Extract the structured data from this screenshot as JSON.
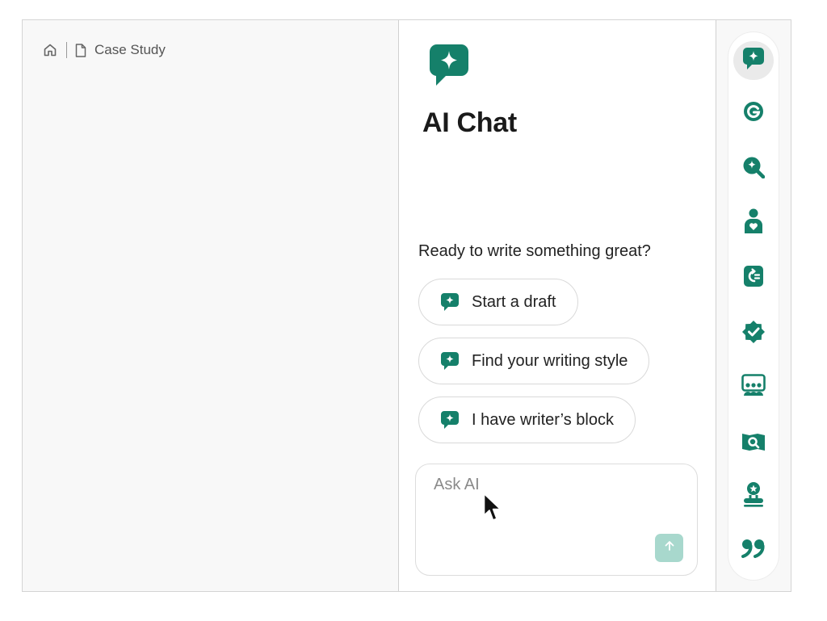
{
  "breadcrumb": {
    "home_icon": "home-icon",
    "doc_icon": "document-icon",
    "label": "Case Study"
  },
  "chat": {
    "logo_icon": "ai-chat-sparkle-bubble-icon",
    "title": "AI Chat",
    "prompt": "Ready to write something great?",
    "suggestions": [
      {
        "label": "Start a draft",
        "icon": "sparkle-bubble-icon"
      },
      {
        "label": "Find your writing style",
        "icon": "sparkle-bubble-icon"
      },
      {
        "label": "I have writer’s block",
        "icon": "sparkle-bubble-icon"
      }
    ],
    "input": {
      "placeholder": "Ask AI",
      "value": ""
    },
    "send_icon": "arrow-up-icon"
  },
  "rail": {
    "items": [
      {
        "icon": "ai-chat-icon",
        "active": true
      },
      {
        "icon": "grammarly-g-icon",
        "active": false
      },
      {
        "icon": "ai-detector-search-icon",
        "active": false
      },
      {
        "icon": "humanizer-person-icon",
        "active": false
      },
      {
        "icon": "paraphraser-icon",
        "active": false
      },
      {
        "icon": "proofreader-badge-check-icon",
        "active": false
      },
      {
        "icon": "reader-reactions-icon",
        "active": false
      },
      {
        "icon": "plagiarism-checker-icon",
        "active": false
      },
      {
        "icon": "expert-review-icon",
        "active": false
      },
      {
        "icon": "citation-quote-icon",
        "active": false
      }
    ]
  },
  "colors": {
    "brand": "#15806a",
    "send_disabled": "#a8d8cd",
    "doc_background": "#f8f8f8",
    "rail_active": "#eaeaea"
  }
}
